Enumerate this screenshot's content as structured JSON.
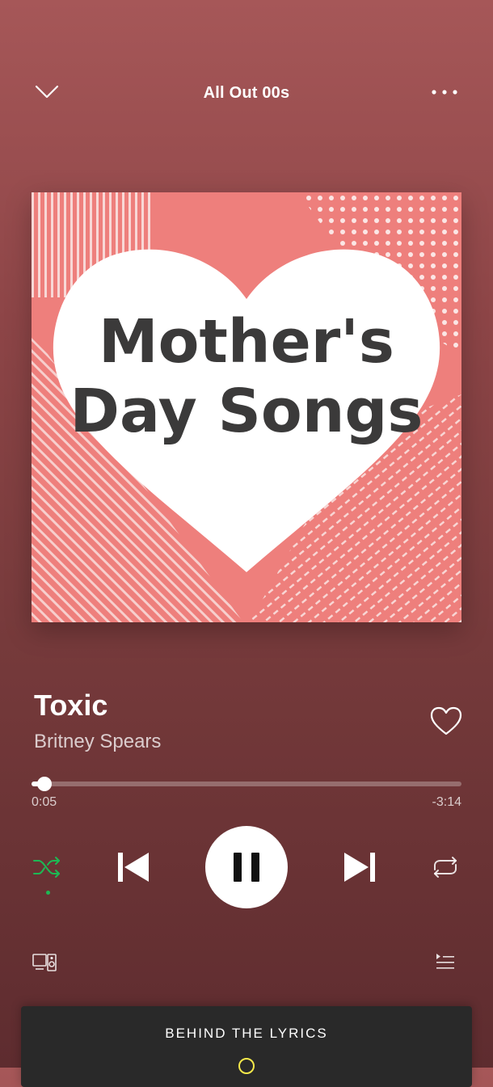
{
  "header": {
    "collapse_icon": "chevron-down-icon",
    "title": "All Out 00s",
    "more_icon": "more-horizontal-icon"
  },
  "cover": {
    "line1": "Mother's",
    "line2": "Day Songs",
    "bg_color": "#ee7f7c"
  },
  "track": {
    "title": "Toxic",
    "artist": "Britney Spears",
    "liked": false
  },
  "playback": {
    "elapsed": "0:05",
    "remaining": "-3:14",
    "progress_fraction": 0.03,
    "is_playing": true,
    "shuffle_on": true,
    "repeat_on": false
  },
  "controls": {
    "shuffle_icon": "shuffle-icon",
    "prev_icon": "skip-back-icon",
    "play_pause_icon": "pause-icon",
    "next_icon": "skip-forward-icon",
    "repeat_icon": "repeat-icon"
  },
  "footer": {
    "devices_icon": "devices-icon",
    "queue_icon": "queue-icon"
  },
  "lyrics_card": {
    "label": "BEHIND THE LYRICS"
  },
  "colors": {
    "accent_green": "#1db954",
    "background_top": "#a65758",
    "background_bottom": "#5e2c2f",
    "card_bg": "#292929"
  }
}
